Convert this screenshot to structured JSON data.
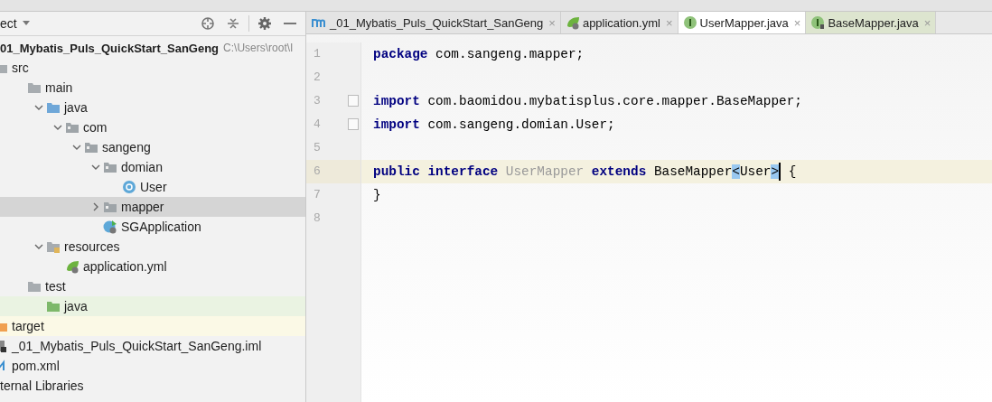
{
  "project_panel": {
    "view_label": "ect",
    "root": {
      "name": "01_Mybatis_Puls_QuickStart_SanGeng",
      "path": "C:\\Users\\root\\I"
    },
    "tree": [
      {
        "label": "src",
        "kind": "folder",
        "children": [
          {
            "label": "main",
            "kind": "folder",
            "children": [
              {
                "label": "java",
                "kind": "source-folder",
                "expanded": true,
                "children": [
                  {
                    "label": "com",
                    "kind": "package",
                    "expanded": true,
                    "children": [
                      {
                        "label": "sangeng",
                        "kind": "package",
                        "expanded": true,
                        "children": [
                          {
                            "label": "domian",
                            "kind": "package",
                            "expanded": true,
                            "children": [
                              {
                                "label": "User",
                                "kind": "class"
                              }
                            ]
                          },
                          {
                            "label": "mapper",
                            "kind": "package",
                            "expanded": false,
                            "selected": true
                          },
                          {
                            "label": "SGApplication",
                            "kind": "app"
                          }
                        ]
                      }
                    ]
                  }
                ]
              },
              {
                "label": "resources",
                "kind": "resources-folder",
                "expanded": true,
                "children": [
                  {
                    "label": "application.yml",
                    "kind": "yml"
                  }
                ]
              }
            ]
          },
          {
            "label": "test",
            "kind": "folder",
            "children": [
              {
                "label": "java",
                "kind": "test-folder",
                "color": "#eaf3e2"
              }
            ]
          }
        ]
      },
      {
        "label": "target",
        "kind": "excluded-folder",
        "color": "#fbf9e6"
      },
      {
        "label": "_01_Mybatis_Puls_QuickStart_SanGeng.iml",
        "kind": "module-file"
      },
      {
        "label": "pom.xml",
        "kind": "maven-file"
      },
      {
        "label": "ternal Libraries",
        "kind": "library"
      }
    ]
  },
  "editor": {
    "tabs": [
      {
        "label": "_01_Mybatis_Puls_QuickStart_SanGeng",
        "kind": "module",
        "selected": false,
        "close": "×"
      },
      {
        "label": "application.yml",
        "kind": "yml",
        "selected": false,
        "close": "×"
      },
      {
        "label": "UserMapper.java",
        "kind": "interface",
        "selected": true,
        "close": "×"
      },
      {
        "label": "BaseMapper.java",
        "kind": "interface-lib",
        "selected": false,
        "close": "×"
      }
    ],
    "lines": [
      {
        "number": "1",
        "segments": [
          {
            "kind": "keyword",
            "text": "package"
          },
          {
            "kind": "plain",
            "text": " com.sangeng.mapper;"
          }
        ]
      },
      {
        "number": "2"
      },
      {
        "number": "3",
        "foldable": true,
        "segments": [
          {
            "kind": "keyword",
            "text": "import"
          },
          {
            "kind": "plain",
            "text": " com.baomidou.mybatisplus.core.mapper.BaseMapper;"
          }
        ]
      },
      {
        "number": "4",
        "foldable": true,
        "segments": [
          {
            "kind": "keyword",
            "text": "import"
          },
          {
            "kind": "plain",
            "text": " com.sangeng.domian.User;"
          }
        ]
      },
      {
        "number": "5"
      },
      {
        "number": "6",
        "current": true,
        "segments": [
          {
            "kind": "keyword",
            "text": "public interface"
          },
          {
            "kind": "unused",
            "text": " UserMapper"
          },
          {
            "kind": "keyword",
            "text": " extends"
          },
          {
            "kind": "plain",
            "text": " BaseMapper"
          },
          {
            "kind": "brace-match",
            "text": "<"
          },
          {
            "kind": "plain",
            "text": "User"
          },
          {
            "kind": "brace-match",
            "text": ">",
            "caret": true
          },
          {
            "kind": "plain",
            "text": " {"
          }
        ]
      },
      {
        "number": "7",
        "segments": [
          {
            "kind": "plain",
            "text": "}"
          }
        ]
      },
      {
        "number": "8"
      }
    ]
  }
}
